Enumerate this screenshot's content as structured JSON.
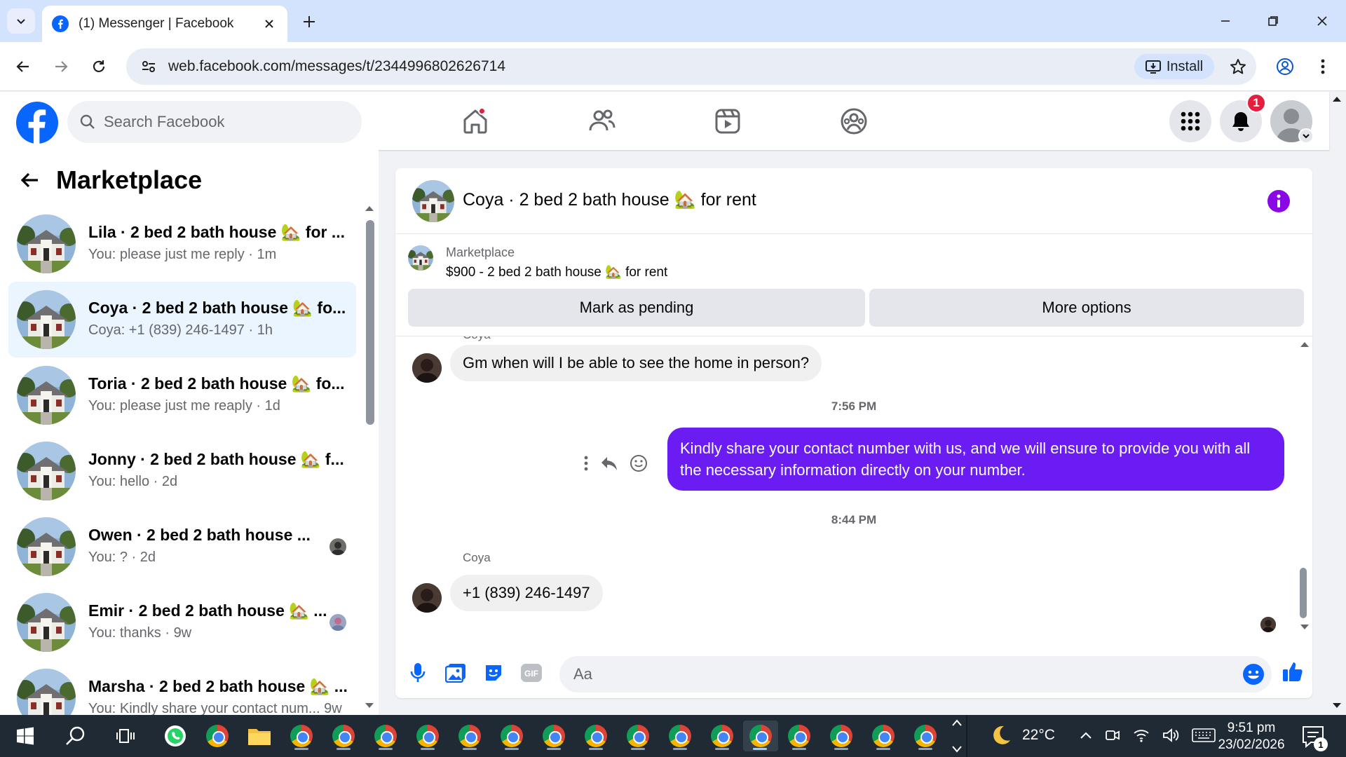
{
  "browser": {
    "tab_title": "(1) Messenger | Facebook",
    "url": "web.facebook.com/messages/t/2344996802626714",
    "install_label": "Install"
  },
  "facebook": {
    "search_placeholder": "Search Facebook",
    "notifications_count": "1",
    "brand_color": "#0866ff"
  },
  "left_panel": {
    "title": "Marketplace",
    "conversations": [
      {
        "name": "Lila · 2 bed 2 bath house 🏡 for ...",
        "preview": "You: please just me reply · 1m",
        "active": false
      },
      {
        "name": "Coya · 2 bed 2 bath house 🏡 fo...",
        "preview": "Coya: +1 (839) 246-1497 · 1h",
        "active": true
      },
      {
        "name": "Toria · 2 bed 2 bath house 🏡 fo...",
        "preview": "You: please just me reaply · 1d",
        "active": false
      },
      {
        "name": "Jonny · 2 bed 2 bath house 🏡 f...",
        "preview": "You: hello · 2d",
        "active": false
      },
      {
        "name": "Owen · 2 bed 2 bath house ...",
        "preview": "You: ? · 2d",
        "active": false
      },
      {
        "name": "Emir · 2 bed 2 bath house 🏡 ...",
        "preview": "You: thanks · 9w",
        "active": false
      },
      {
        "name": "Marsha · 2 bed 2 bath house 🏡 ...",
        "preview": "You: Kindly share your contact num... 9w",
        "active": false
      }
    ]
  },
  "chat": {
    "title": "Coya · 2 bed 2 bath house 🏡 for rent",
    "listing_label": "Marketplace",
    "listing_price": "$900 - 2 bed 2 bath house 🏡 for rent",
    "mark_pending_label": "Mark as pending",
    "more_options_label": "More options",
    "sender_name_top": "Coya",
    "msg1": "Gm when will I be able to see the home in person?",
    "time1": "7:56 PM",
    "msg2": "Kindly share your contact number with us, and we will ensure to provide you with all the necessary information directly on your number.",
    "time2": "8:44 PM",
    "sender_name": "Coya",
    "msg3": "+1 (839) 246-1497",
    "composer_placeholder": "Aa",
    "accent_color": "#6a1cf3"
  },
  "taskbar": {
    "temperature": "22°C",
    "time": "9:51 pm",
    "date": "23/02/2026",
    "notification_count": "1"
  }
}
